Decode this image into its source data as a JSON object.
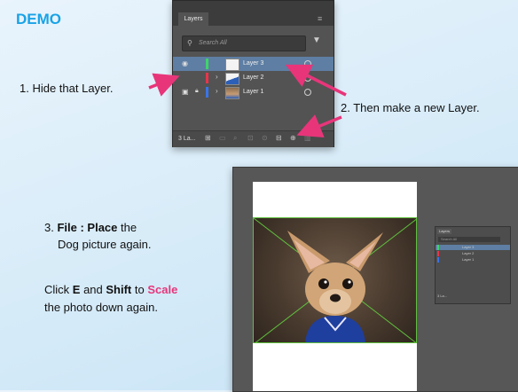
{
  "demo_title": "DEMO",
  "steps": {
    "step1": "1. Hide that Layer.",
    "step2": "2. Then make a new Layer.",
    "step3": {
      "prefix": "3. ",
      "bold": "File : Place",
      "rest": " the",
      "line2": "Dog picture again."
    },
    "step4": {
      "t1": "Click ",
      "b1": "E",
      "t2": " and ",
      "b2": "Shift",
      "t3": " to ",
      "pink": "Scale",
      "line2": "the photo down again."
    }
  },
  "layers_panel": {
    "tab_label": "Layers",
    "search_placeholder": "Search All",
    "layers": [
      {
        "name": "Layer 3",
        "color": "#3fd46a",
        "selected": true
      },
      {
        "name": "Layer 2",
        "color": "#e8354b",
        "selected": false
      },
      {
        "name": "Layer 1",
        "color": "#3a74e8",
        "selected": false
      }
    ],
    "layer_count": "3 La..."
  },
  "mini_panel": {
    "tab_label": "Layers",
    "search_placeholder": "Search All",
    "layers": [
      "Layer 3",
      "Layer 2",
      "Layer 1"
    ],
    "footer_count": "3 La..."
  },
  "colors": {
    "accent_blue": "#19a3e6",
    "annotation_pink": "#e8357a",
    "selection_green": "#5fbf3d"
  },
  "icons": [
    "search-icon",
    "filter-icon",
    "eye-icon",
    "lock-icon",
    "chevron-right-icon",
    "new-layer-icon",
    "trash-icon"
  ]
}
